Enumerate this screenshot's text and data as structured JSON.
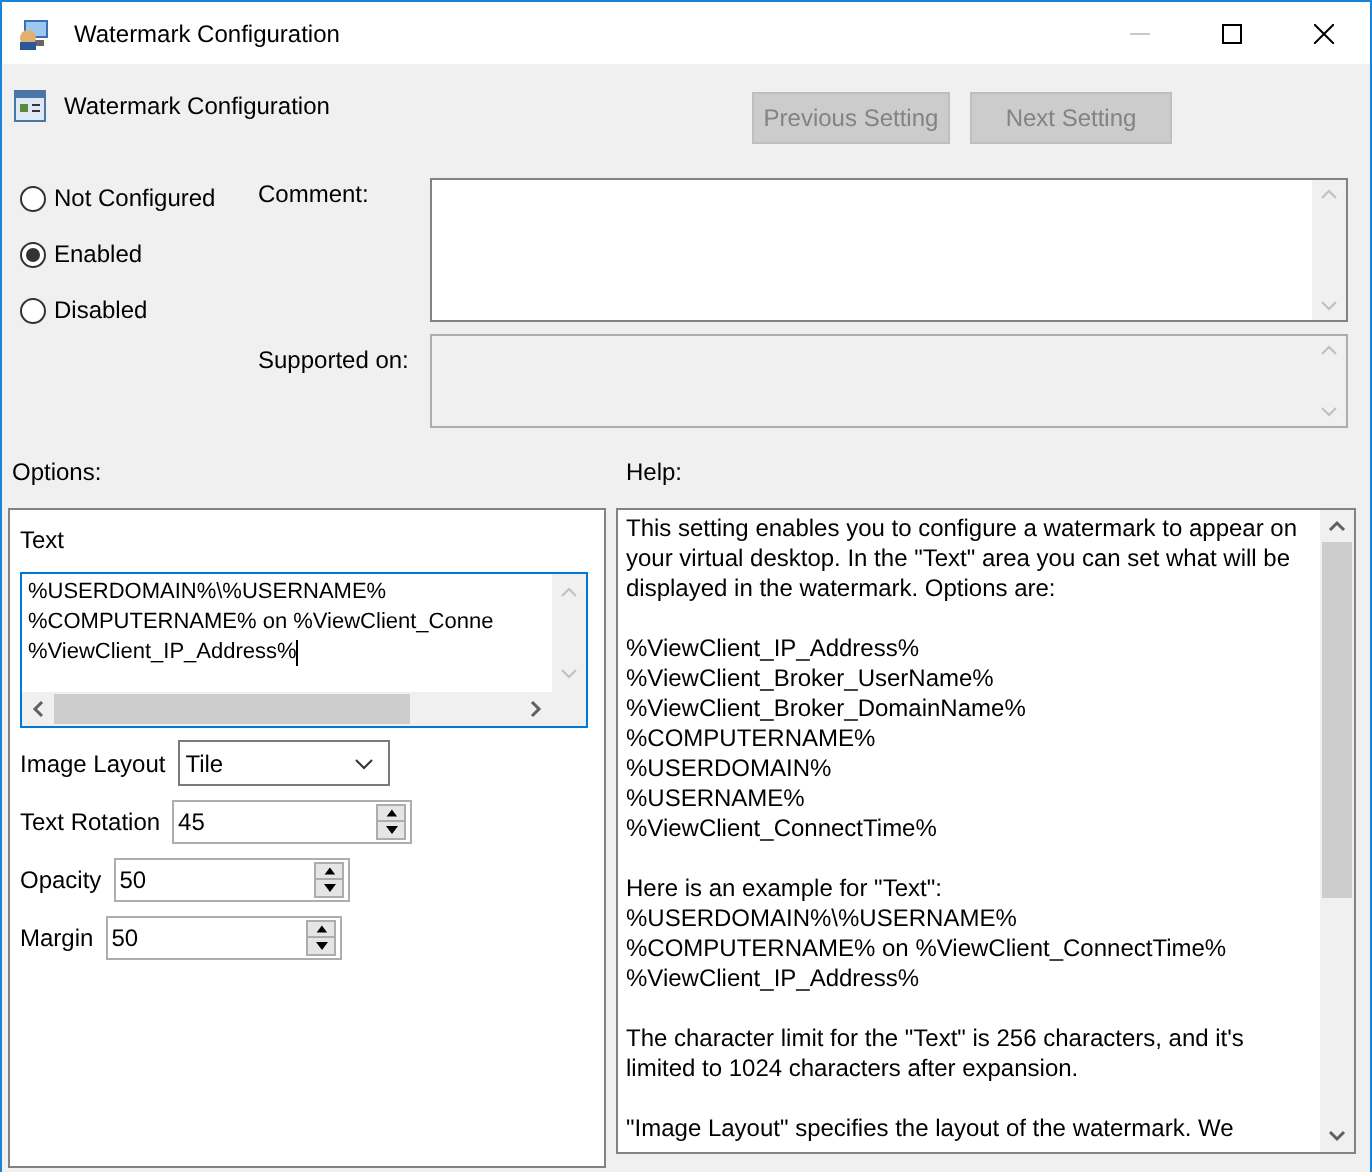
{
  "window": {
    "title": "Watermark Configuration",
    "controls": [
      {
        "kind": "minimize",
        "disabled": true
      },
      {
        "kind": "maximize",
        "disabled": false
      },
      {
        "kind": "close",
        "disabled": false
      }
    ]
  },
  "header": {
    "title": "Watermark Configuration",
    "buttons": [
      {
        "label": "Previous Setting",
        "disabled": true
      },
      {
        "label": "Next Setting",
        "disabled": true
      }
    ]
  },
  "state_options": [
    {
      "label": "Not Configured",
      "selected": false
    },
    {
      "label": "Enabled",
      "selected": true
    },
    {
      "label": "Disabled",
      "selected": false
    }
  ],
  "comment": {
    "label": "Comment:"
  },
  "supported_on": {
    "label": "Supported on:"
  },
  "options": {
    "label": "Options:",
    "text_label": "Text",
    "text_lines": [
      "%USERDOMAIN%\\%USERNAME%",
      "%COMPUTERNAME% on %ViewClient_Conne",
      "%ViewClient_IP_Address%"
    ],
    "fields": [
      {
        "kind": "dropdown",
        "label": "Image Layout",
        "value": "Tile"
      },
      {
        "kind": "spinner",
        "label": "Text Rotation",
        "value": "45"
      },
      {
        "kind": "spinner",
        "label": "Opacity",
        "value": "50"
      },
      {
        "kind": "spinner",
        "label": "Margin",
        "value": "50"
      }
    ]
  },
  "help": {
    "label": "Help:",
    "paragraphs": [
      [
        "This setting enables you to configure a watermark to appear on your virtual desktop. In the \"Text\" area you can set what will be displayed in the watermark. Options are:"
      ],
      [
        "%ViewClient_IP_Address%",
        "%ViewClient_Broker_UserName%",
        "%ViewClient_Broker_DomainName%",
        "%COMPUTERNAME%",
        "%USERDOMAIN%",
        "%USERNAME%",
        "%ViewClient_ConnectTime%"
      ],
      [
        "Here is an example for \"Text\":",
        "%USERDOMAIN%\\%USERNAME%",
        "%COMPUTERNAME% on %ViewClient_ConnectTime%",
        "%ViewClient_IP_Address%"
      ],
      [
        "The character limit for the \"Text\" is 256 characters, and it's limited to 1024 characters after expansion."
      ],
      [
        "\"Image Layout\" specifies the layout of the watermark. We"
      ]
    ]
  }
}
